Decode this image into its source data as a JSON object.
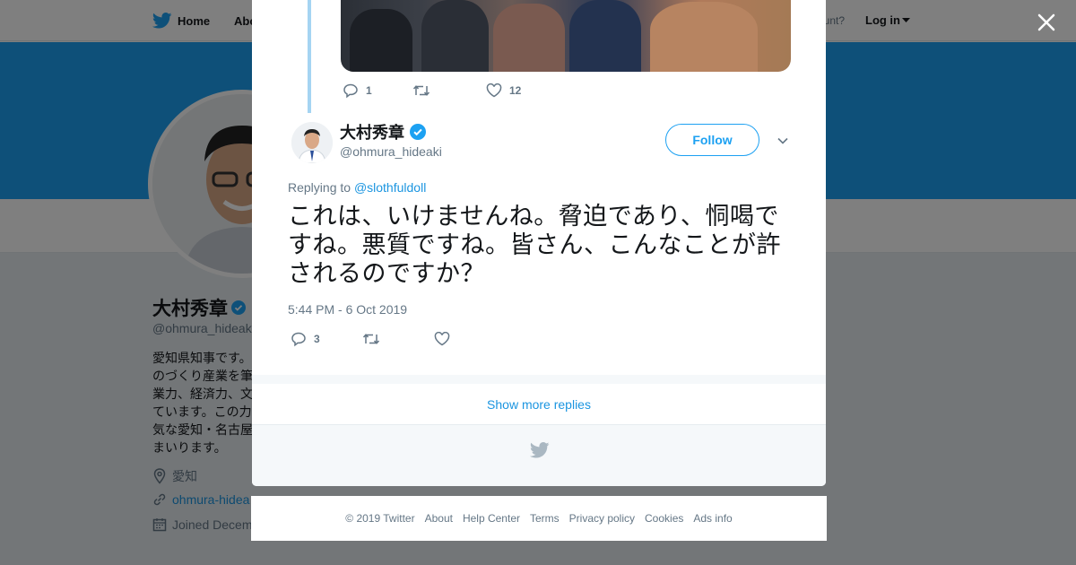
{
  "colors": {
    "brand_blue": "#1da1f2",
    "link_blue": "#1b95e0",
    "text_dark": "#14171a",
    "text_gray": "#657786",
    "verified": "#1da1f2"
  },
  "topnav": {
    "home_label": "Home",
    "about_label": "Abo",
    "account_text": "ccount?",
    "login_label": "Log in"
  },
  "profile": {
    "name": "大村秀章",
    "handle": "@ohmura_hideak",
    "bio": "愛知県知事です。\nのづくり産業を筆\n業力、経済力、文\nています。この力\n気な愛知・名古屋\nまいります。",
    "location": "愛知",
    "website": "ohmura-hidea",
    "joined": "Joined Decem"
  },
  "previous_tweet": {
    "reply_count": "1",
    "retweet_count": "",
    "like_count": "12"
  },
  "tweet": {
    "name": "大村秀章",
    "handle": "@ohmura_hideaki",
    "follow_label": "Follow",
    "replying_prefix": "Replying to ",
    "replying_to": "@slothfuldoll",
    "text": "これは、いけませんね。脅迫であり、恫喝ですね。悪質ですね。皆さん、こんなことが許されるのですか？",
    "timestamp": "5:44 PM - 6 Oct 2019",
    "reply_count": "3",
    "retweet_count": "",
    "like_count": ""
  },
  "show_more_label": "Show more replies",
  "icons": [
    "twitter-bird-icon",
    "caret-down-icon",
    "close-icon",
    "verified-badge-icon",
    "reply-icon",
    "retweet-icon",
    "like-icon",
    "chevron-down-icon",
    "location-icon",
    "link-icon",
    "calendar-icon"
  ],
  "footer": {
    "copyright": "© 2019 Twitter",
    "links": [
      "About",
      "Help Center",
      "Terms",
      "Privacy policy",
      "Cookies",
      "Ads info"
    ]
  }
}
